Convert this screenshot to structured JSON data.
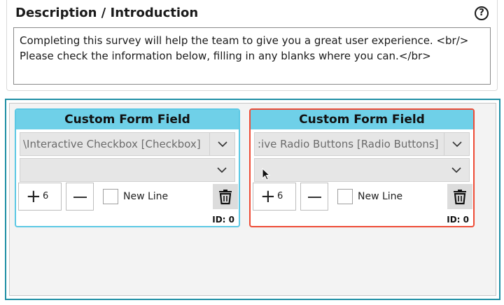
{
  "description": {
    "title": "Description / Introduction",
    "help_icon": "question-circle-icon",
    "text_line1": "Completing this survey will help the team to give you a great user experience. <br/>",
    "text_line2": "Please check the information below, filling in any blanks where you can.</br>"
  },
  "fields": [
    {
      "header": "Custom Form Field",
      "type_value": "Interactive Checkbox [Checkbox]",
      "type_visible": "\\Interactive Checkbox [Checkbox]",
      "second_value": "",
      "count": "6",
      "new_line_label": "New Line",
      "id_label": "ID: 0",
      "selected": false
    },
    {
      "header": "Custom Form Field",
      "type_value": "Interactive Radio Buttons [Radio Buttons]",
      "type_visible": ":ive Radio Buttons [Radio Buttons]",
      "second_value": "",
      "count": "6",
      "new_line_label": "New Line",
      "id_label": "ID: 0",
      "selected": true
    }
  ],
  "colors": {
    "accent": "#1f8fa5",
    "card_header": "#6fd0e8",
    "card_border": "#5bc8e4",
    "selected_border": "#ee4b35"
  }
}
